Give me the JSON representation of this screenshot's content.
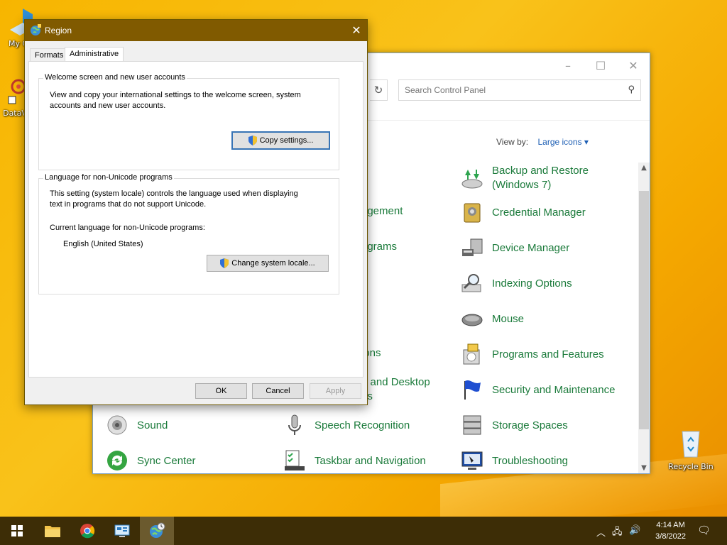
{
  "desktop": {
    "icons": [
      {
        "label": "My Co",
        "icon": "computer-icon"
      },
      {
        "label": "DataV",
        "icon": "app-icon"
      },
      {
        "label": "Recycle Bin",
        "icon": "recycle-bin-icon"
      }
    ]
  },
  "control_panel": {
    "search_placeholder": "Search Control Panel",
    "view_by_label": "View by:",
    "view_by_value": "Large icons",
    "items": [
      {
        "label": "Backup and Restore",
        "label2": "(Windows 7)",
        "icon": "backup-restore-icon"
      },
      {
        "label": "agement",
        "icon": ""
      },
      {
        "label": "Credential Manager",
        "icon": "credential-manager-icon"
      },
      {
        "label": "ograms",
        "icon": ""
      },
      {
        "label": "Device Manager",
        "icon": "device-manager-icon"
      },
      {
        "label": "y",
        "icon": ""
      },
      {
        "label": "Indexing Options",
        "icon": "indexing-options-icon"
      },
      {
        "label": "Mouse",
        "icon": "mouse-icon"
      },
      {
        "label": "ions",
        "icon": ""
      },
      {
        "label": "Programs and Features",
        "icon": "programs-features-icon"
      },
      {
        "label": "p and Desktop",
        "label2": "ns",
        "icon": ""
      },
      {
        "label": "Security and Maintenance",
        "icon": "security-maintenance-icon"
      },
      {
        "label": "Sound",
        "icon": "sound-icon"
      },
      {
        "label": "Speech Recognition",
        "icon": "microphone-icon"
      },
      {
        "label": "Storage Spaces",
        "icon": "storage-spaces-icon"
      },
      {
        "label": "Sync Center",
        "icon": "sync-center-icon"
      },
      {
        "label": "Taskbar and Navigation",
        "icon": "taskbar-icon"
      },
      {
        "label": "Troubleshooting",
        "icon": "troubleshooting-icon"
      }
    ]
  },
  "region_dialog": {
    "title": "Region",
    "tabs": [
      "Formats",
      "Administrative"
    ],
    "active_tab": "Administrative",
    "welcome_group": {
      "title": "Welcome screen and new user accounts",
      "line1": "View and copy your international settings to the welcome screen, system",
      "line2": "accounts and new user accounts.",
      "button": "Copy settings..."
    },
    "locale_group": {
      "title": "Language for non-Unicode programs",
      "line1": "This setting (system locale) controls the language used when displaying",
      "line2": "text in programs that do not support Unicode.",
      "current_label": "Current language for non-Unicode programs:",
      "current_value": "English (United States)",
      "button": "Change system locale..."
    },
    "buttons": {
      "ok": "OK",
      "cancel": "Cancel",
      "apply": "Apply"
    }
  },
  "taskbar": {
    "time": "4:14 AM",
    "date": "3/8/2022",
    "apps": [
      "start-icon",
      "file-explorer-icon",
      "chrome-icon",
      "control-panel-icon",
      "region-icon"
    ]
  }
}
